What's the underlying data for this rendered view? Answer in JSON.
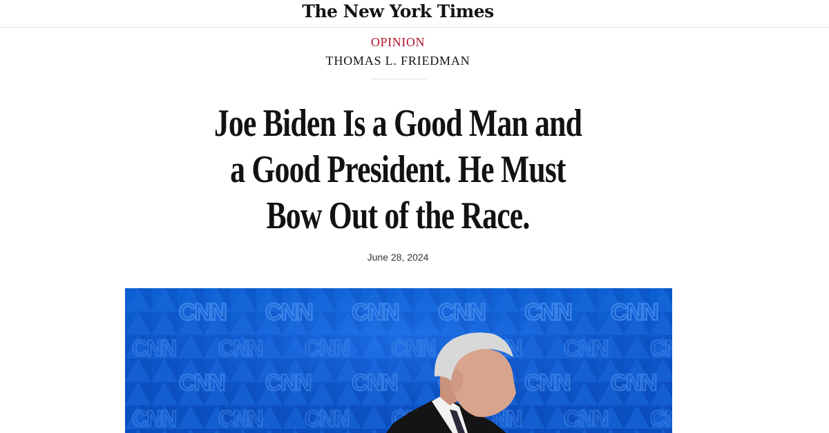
{
  "masthead": {
    "logo_text": "The New York Times"
  },
  "article": {
    "section": "OPINION",
    "author": "THOMAS L. FRIEDMAN",
    "headline": "Joe Biden Is a Good Man and a Good President. He Must Bow Out of the Race.",
    "date": "June 28, 2024"
  },
  "photo": {
    "backdrop_text": "CNN",
    "colors": {
      "backdrop": "#0a56cc",
      "backdrop_text": "#3f86ea",
      "suit": "#141414",
      "shirt": "#f2f2f2",
      "hair": "#d8d8d8",
      "skin": "#d8a48c"
    }
  },
  "theme": {
    "kicker_color": "#b0112b",
    "text_color": "#121212",
    "rule_color": "#dcdcdc"
  }
}
